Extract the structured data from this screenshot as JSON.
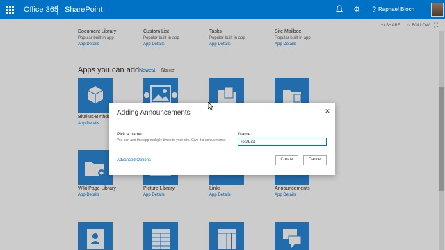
{
  "suite_bar": {
    "brand": "Office 365",
    "app_name": "SharePoint",
    "user_name": "Raphael Bloch",
    "icons": [
      "waffle-icon",
      "bell-icon",
      "gear-icon",
      "help-icon"
    ],
    "accent_color": "#0072c6"
  },
  "page_actions": {
    "share": "SHARE",
    "follow": "FOLLOW"
  },
  "top_apps": [
    {
      "name": "Document Library",
      "subtitle": "Popular built-in app",
      "link": "App Details"
    },
    {
      "name": "Custom List",
      "subtitle": "Popular built-in app",
      "link": "App Details"
    },
    {
      "name": "Tasks",
      "subtitle": "Popular built-in app",
      "link": "App Details"
    },
    {
      "name": "Site Mailbox",
      "subtitle": "Popular built-in app",
      "link": "App Details"
    }
  ],
  "apps_section": {
    "heading": "Apps you can add",
    "sort_newest": "Newest",
    "sort_name": "Name"
  },
  "row1_apps": [
    {
      "name": "Bitalius-Birthda",
      "link": "App Details",
      "icon": "cubes-icon"
    },
    {
      "name": "",
      "link": "",
      "icon": "picture-icon"
    },
    {
      "name": "",
      "link": "",
      "icon": "folder-doc-icon"
    },
    {
      "name": "",
      "link": "",
      "icon": "folder-icon"
    }
  ],
  "row2_apps": [
    {
      "name": "Wiki Page Library",
      "link": "App Details",
      "icon": "wiki-folder-icon"
    },
    {
      "name": "Picture Library",
      "link": "App Details",
      "icon": "picture-icon"
    },
    {
      "name": "Links",
      "link": "App Details",
      "icon": "links-icon"
    },
    {
      "name": "Announcements",
      "link": "App Details",
      "icon": "announcement-icon"
    }
  ],
  "row3_apps": [
    {
      "icon": "contacts-icon"
    },
    {
      "icon": "calendar-icon"
    },
    {
      "icon": "table-icon"
    },
    {
      "icon": "discussion-icon"
    }
  ],
  "dialog": {
    "title": "Adding Announcements",
    "pick_label": "Pick a name",
    "pick_description": "You can add this app multiple times to your site. Give it a unique name.",
    "advanced_link": "Advanced Options",
    "name_label": "Name:",
    "name_value": "TestList",
    "create_label": "Create",
    "cancel_label": "Cancel"
  }
}
